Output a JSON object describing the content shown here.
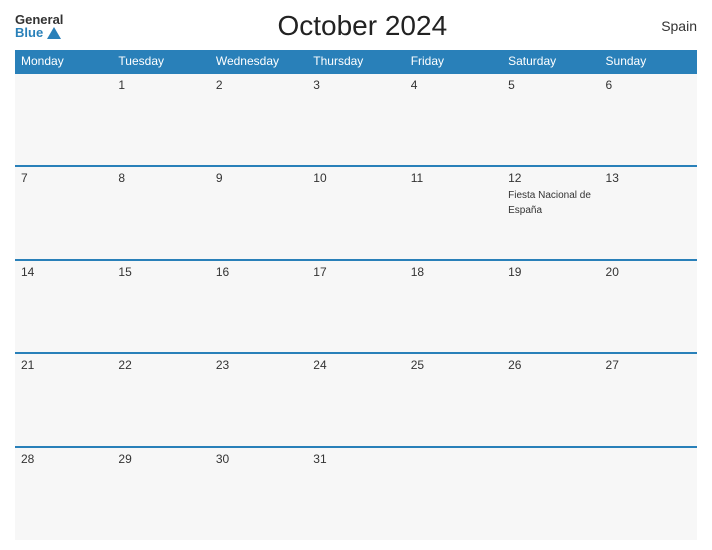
{
  "header": {
    "logo_general": "General",
    "logo_blue": "Blue",
    "title": "October 2024",
    "country": "Spain"
  },
  "weekdays": [
    "Monday",
    "Tuesday",
    "Wednesday",
    "Thursday",
    "Friday",
    "Saturday",
    "Sunday"
  ],
  "weeks": [
    [
      {
        "day": "",
        "empty": true
      },
      {
        "day": "1"
      },
      {
        "day": "2"
      },
      {
        "day": "3"
      },
      {
        "day": "4"
      },
      {
        "day": "5"
      },
      {
        "day": "6"
      }
    ],
    [
      {
        "day": "7"
      },
      {
        "day": "8"
      },
      {
        "day": "9"
      },
      {
        "day": "10"
      },
      {
        "day": "11"
      },
      {
        "day": "12",
        "event": "Fiesta Nacional de España"
      },
      {
        "day": "13"
      }
    ],
    [
      {
        "day": "14"
      },
      {
        "day": "15"
      },
      {
        "day": "16"
      },
      {
        "day": "17"
      },
      {
        "day": "18"
      },
      {
        "day": "19"
      },
      {
        "day": "20"
      }
    ],
    [
      {
        "day": "21"
      },
      {
        "day": "22"
      },
      {
        "day": "23"
      },
      {
        "day": "24"
      },
      {
        "day": "25"
      },
      {
        "day": "26"
      },
      {
        "day": "27"
      }
    ],
    [
      {
        "day": "28"
      },
      {
        "day": "29"
      },
      {
        "day": "30"
      },
      {
        "day": "31"
      },
      {
        "day": "",
        "empty": true
      },
      {
        "day": "",
        "empty": true
      },
      {
        "day": "",
        "empty": true
      }
    ]
  ]
}
